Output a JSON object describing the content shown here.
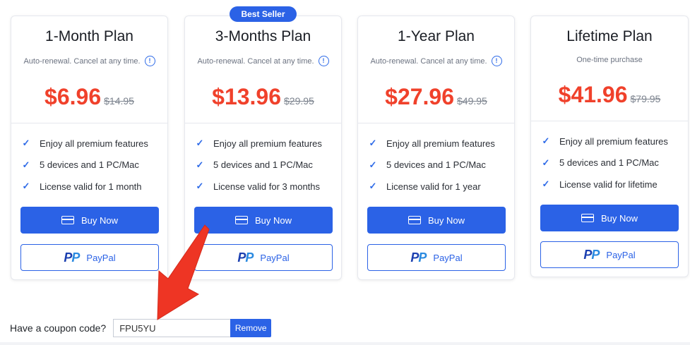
{
  "badge": "Best Seller",
  "plans": [
    {
      "title": "1-Month Plan",
      "subtitle": "Auto-renewal. Cancel at any time.",
      "price": "$6.96",
      "old_price": "$14.95",
      "features": [
        "Enjoy all premium features",
        "5 devices and 1 PC/Mac",
        "License valid for 1 month"
      ],
      "buy_label": "Buy Now",
      "paypal_label": "PayPal"
    },
    {
      "title": "3-Months Plan",
      "subtitle": "Auto-renewal. Cancel at any time.",
      "price": "$13.96",
      "old_price": "$29.95",
      "features": [
        "Enjoy all premium features",
        "5 devices and 1 PC/Mac",
        "License valid for 3 months"
      ],
      "buy_label": "Buy Now",
      "paypal_label": "PayPal"
    },
    {
      "title": "1-Year Plan",
      "subtitle": "Auto-renewal. Cancel at any time.",
      "price": "$27.96",
      "old_price": "$49.95",
      "features": [
        "Enjoy all premium features",
        "5 devices and 1 PC/Mac",
        "License valid for 1 year"
      ],
      "buy_label": "Buy Now",
      "paypal_label": "PayPal"
    },
    {
      "title": "Lifetime Plan",
      "subtitle": "One-time purchase",
      "price": "$41.96",
      "old_price": "$79.95",
      "features": [
        "Enjoy all premium features",
        "5 devices and 1 PC/Mac",
        "License valid for lifetime"
      ],
      "buy_label": "Buy Now",
      "paypal_label": "PayPal"
    }
  ],
  "coupon": {
    "label": "Have a coupon code?",
    "value": "FPU5YU",
    "remove_label": "Remove"
  },
  "colors": {
    "accent": "#2b62e6",
    "price": "#f0412b",
    "annotation_arrow": "#ee3524"
  }
}
